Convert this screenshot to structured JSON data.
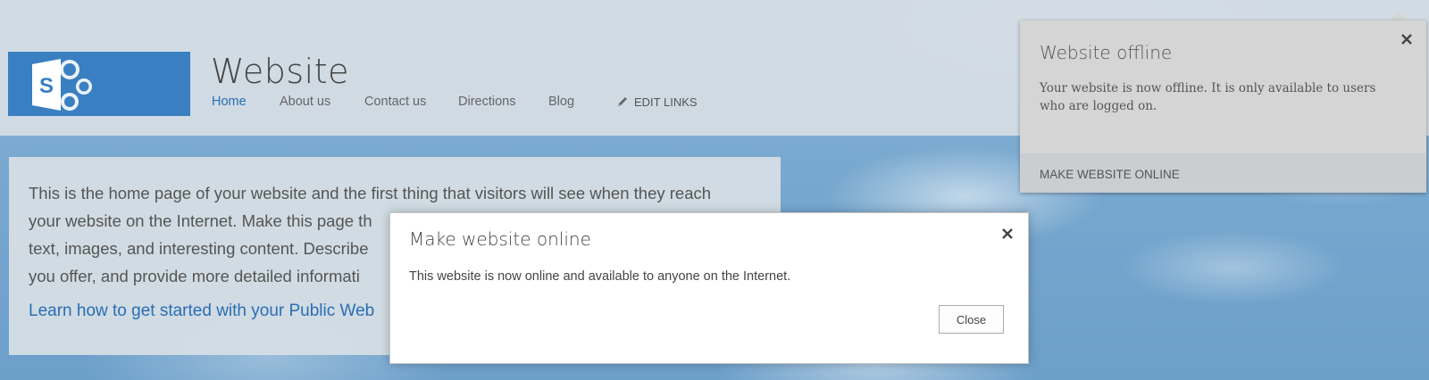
{
  "site": {
    "title": "Website",
    "logo_letter": "S"
  },
  "nav": {
    "items": [
      {
        "label": "Home",
        "active": true
      },
      {
        "label": "About us",
        "active": false
      },
      {
        "label": "Contact us",
        "active": false
      },
      {
        "label": "Directions",
        "active": false
      },
      {
        "label": "Blog",
        "active": false
      }
    ],
    "edit_links_label": "EDIT LINKS"
  },
  "content": {
    "paragraph_lines": [
      "This is the home page of your website and the first thing that visitors will see when they reach",
      "your website on the Internet. Make this page th",
      "text, images, and interesting content. Describe",
      "you offer, and provide more detailed informati"
    ],
    "link": "Learn how to get started with your Public Web"
  },
  "callout": {
    "title": "Website offline",
    "body": "Your website is now offline. It is only available to users who are logged on.",
    "action": "MAKE WEBSITE ONLINE"
  },
  "dialog": {
    "title": "Make website online",
    "body": "This website is now online and available to anyone on the Internet.",
    "button": "Close"
  },
  "colors": {
    "accent": "#2a6eb3",
    "logo_bg": "#3a7fc1"
  }
}
